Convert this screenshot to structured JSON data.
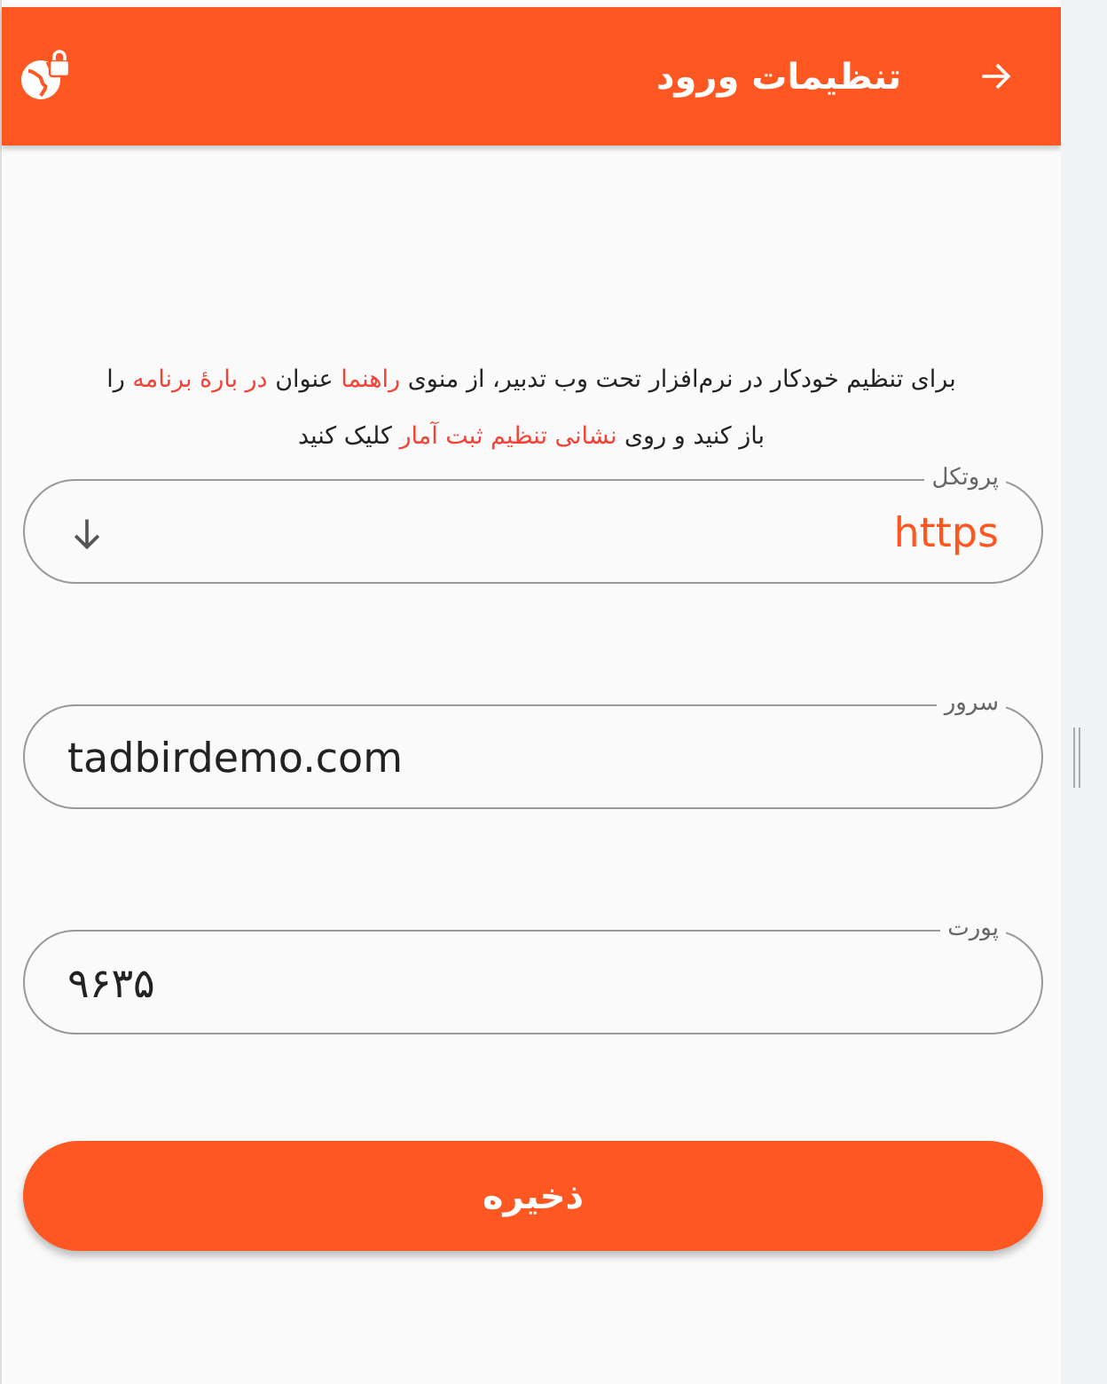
{
  "header": {
    "title": "تنظیمات ورود"
  },
  "instructions": [
    {
      "text": "برای تنظیم خودکار در نرم‌افزار تحت وب تدبیر، از منوی ",
      "highlight": false
    },
    {
      "text": "راهنما",
      "highlight": true
    },
    {
      "text": " عنوان ",
      "highlight": false
    },
    {
      "text": "در بارهٔ برنامه",
      "highlight": true
    },
    {
      "text": " را باز کنید و روی ",
      "highlight": false
    },
    {
      "text": "نشانی تنظیم ثبت آمار",
      "highlight": true
    },
    {
      "text": " کلیک کنید",
      "highlight": false
    }
  ],
  "fields": [
    {
      "kind": "select",
      "label": "پروتکل",
      "value": "https"
    },
    {
      "kind": "text",
      "label": "سرور",
      "value": "tadbirdemo.com"
    },
    {
      "kind": "text",
      "label": "پورت",
      "value": "۹۶۳۵"
    }
  ],
  "save_button": "ذخیره"
}
